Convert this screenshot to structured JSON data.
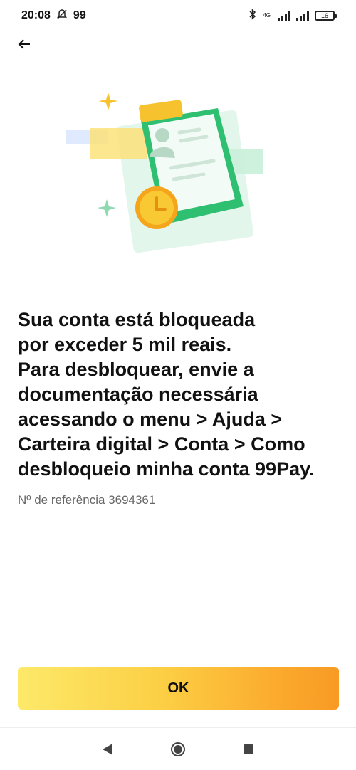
{
  "status_bar": {
    "time": "20:08",
    "notification_count": "99",
    "network_label": "4G",
    "battery": "16"
  },
  "message": "Sua conta está bloqueada\npor exceder 5 mil reais.\nPara desbloquear, envie a\ndocumentação necessária\nacessando o menu > Ajuda >\nCarteira digital > Conta > Como\ndesbloqueio minha conta 99Pay.",
  "reference": "Nº de referência 3694361",
  "ok_button": "OK",
  "icons": {
    "back": "back-arrow-icon",
    "illustration": "document-clock-illustration"
  },
  "colors": {
    "button_gradient_start": "#fde96a",
    "button_gradient_end": "#f89a24",
    "accent_green": "#2fbf71",
    "accent_yellow": "#f6c22e"
  }
}
